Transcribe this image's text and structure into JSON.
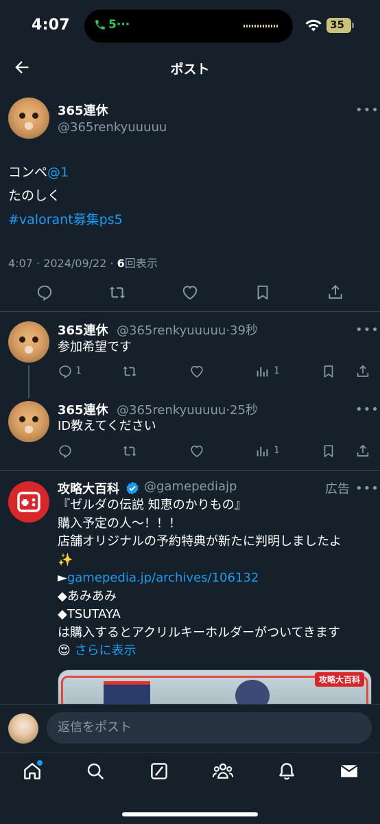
{
  "status_bar": {
    "time": "4:07",
    "call_count": "5",
    "battery": "35"
  },
  "header": {
    "title": "ポスト"
  },
  "post": {
    "name": "365連休",
    "handle": "@365renkyuuuuu",
    "line1_text": "コンペ",
    "line1_mention": "@1",
    "line2": "たのしく",
    "hashtag": " #valorant募集ps5",
    "meta_prefix": "4:07 · 2024/09/22 · ",
    "views_count": "6",
    "views_label": "回表示"
  },
  "replies": [
    {
      "name": "365連休",
      "handle": "@365renkyuuuuu",
      "time": "·39秒",
      "text": "参加希望です",
      "reply_count": "1",
      "views": "1"
    },
    {
      "name": "365連休",
      "handle": "@365renkyuuuuu",
      "time": "·25秒",
      "text": "ID教えてください",
      "reply_count": "",
      "views": "1"
    }
  ],
  "ad": {
    "name": "攻略大百科",
    "handle": "@gamepediajp",
    "ad_label": "広告",
    "lines": [
      "『ゼルダの伝説 知恵のかりもの』",
      "購入予定の人～！！！",
      "店舗オリジナルの予約特典が新たに判明しましたよ",
      "✨",
      "",
      "◆あみあみ",
      "◆TSUTAYA",
      "は購入するとアクリルキーホルダーがついてきます"
    ],
    "arrow": "►",
    "link": "gamepedia.jp/archives/106132",
    "emoji": "😍",
    "show_more": "さらに表示",
    "image_tag": "攻略大百科"
  },
  "reply_bar": {
    "placeholder": "返信をポスト"
  },
  "colors": {
    "background": "#15202b",
    "accent": "#1d9bf0",
    "muted": "#8b98a5",
    "divider": "#38444d"
  }
}
